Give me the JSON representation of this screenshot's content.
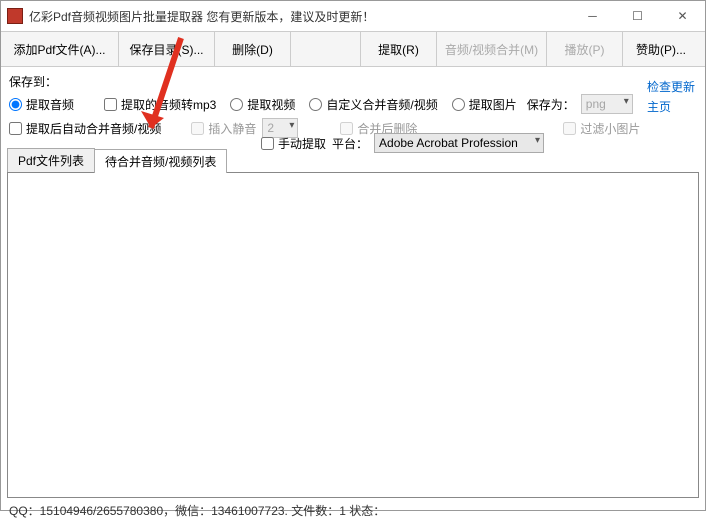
{
  "window": {
    "title": "亿彩Pdf音频视频图片批量提取器    您有更新版本，建议及时更新！"
  },
  "toolbar": {
    "add_pdf": "添加Pdf文件(A)...",
    "save_dir": "保存目录(S)...",
    "delete": "删除(D)",
    "extract": "提取(R)",
    "merge_av": "音频/视频合并(M)",
    "play": "播放(P)",
    "sponsor": "赞助(P)..."
  },
  "options": {
    "save_to_label": "保存到：",
    "radio_extract_audio": "提取音频",
    "chk_mp3": "提取的音频转mp3",
    "radio_extract_video": "提取视频",
    "radio_custom_merge": "自定义合并音频/视频",
    "radio_extract_image": "提取图片",
    "save_as_label": "保存为：",
    "save_as_value": "png",
    "chk_auto_merge": "提取后自动合并音频/视频",
    "chk_insert_silence": "插入静音",
    "silence_value": "2",
    "chk_delete_after_merge": "合并后删除",
    "chk_filter_small": "过滤小图片",
    "chk_manual_extract": "手动提取",
    "platform_label": "平台：",
    "platform_value": "Adobe Acrobat Profession"
  },
  "links": {
    "check_update": "检查更新",
    "homepage": "主页"
  },
  "tabs": {
    "tab_file_list": "Pdf文件列表",
    "tab_merge_list": "待合并音频/视频列表"
  },
  "status": {
    "text": "QQ：15104946/2655780380，微信：13461007723.  文件数：1  状态："
  }
}
